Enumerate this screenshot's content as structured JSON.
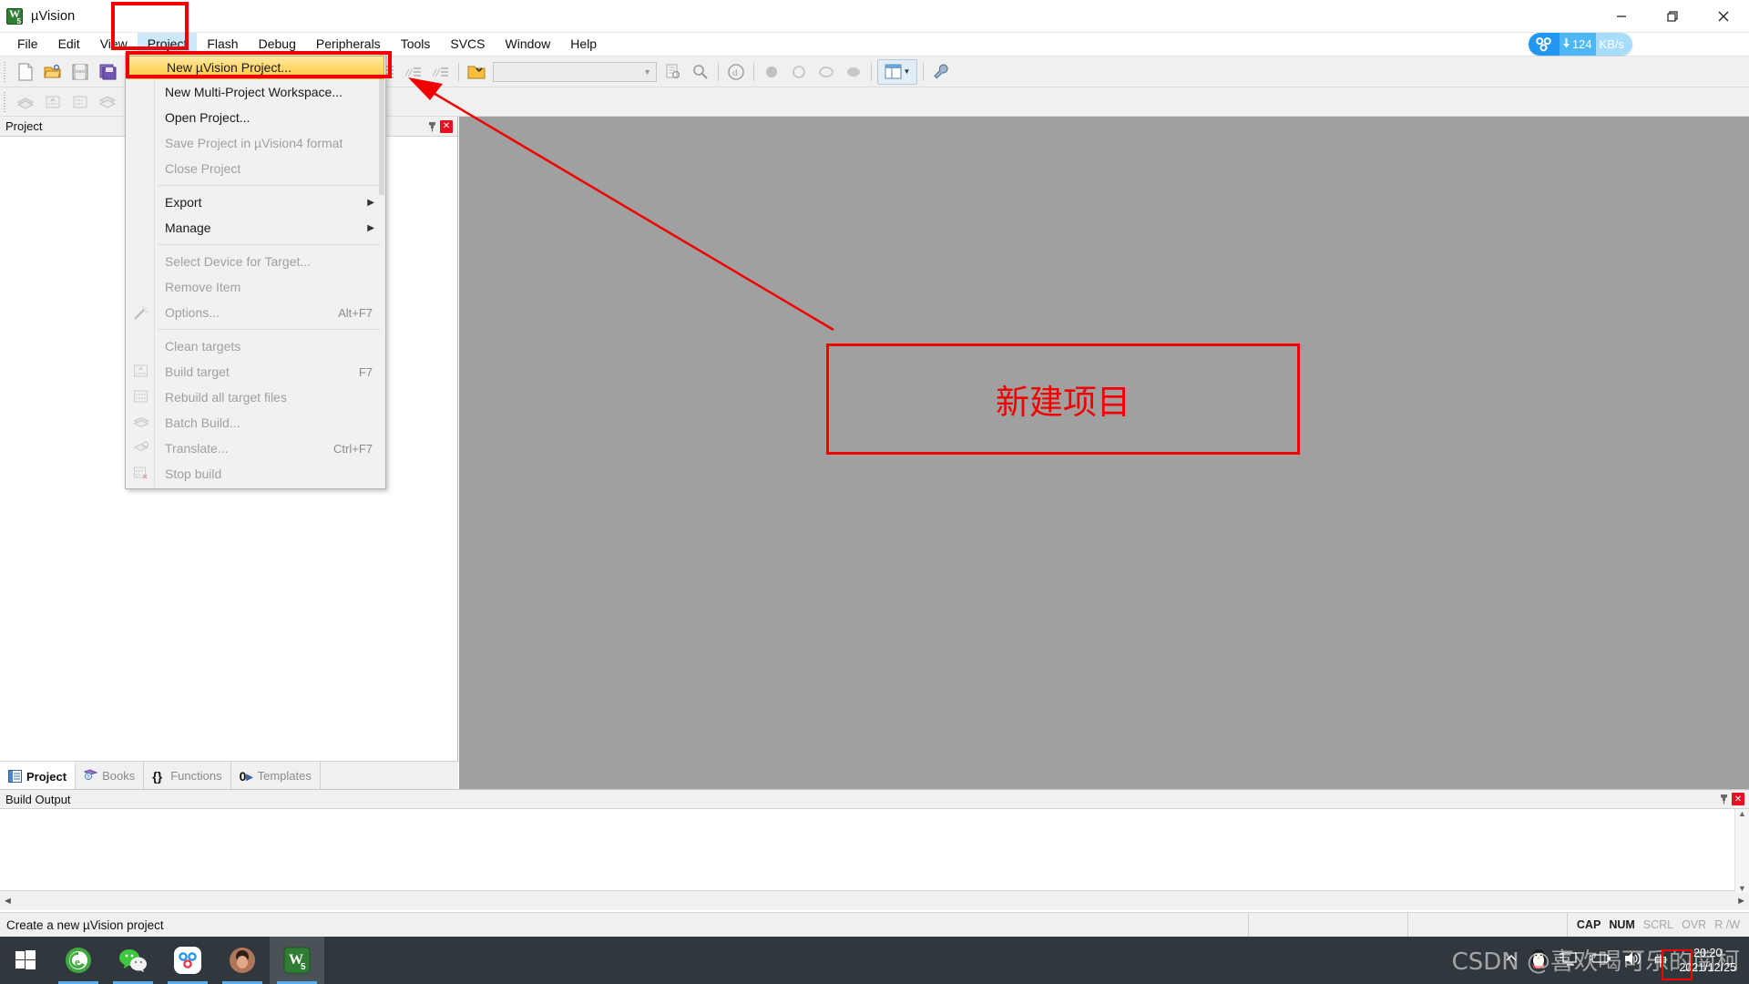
{
  "window": {
    "title": "µVision",
    "app_icon": "uvision-keil-icon",
    "controls": {
      "minimize": "minimize-icon",
      "maximize": "restore-icon",
      "close": "close-icon"
    }
  },
  "menubar": {
    "items": [
      {
        "label": "File",
        "open": false
      },
      {
        "label": "Edit",
        "open": false
      },
      {
        "label": "View",
        "open": false
      },
      {
        "label": "Project",
        "open": true
      },
      {
        "label": "Flash",
        "open": false
      },
      {
        "label": "Debug",
        "open": false
      },
      {
        "label": "Peripherals",
        "open": false
      },
      {
        "label": "Tools",
        "open": false
      },
      {
        "label": "SVCS",
        "open": false
      },
      {
        "label": "Window",
        "open": false
      },
      {
        "label": "Help",
        "open": false
      }
    ]
  },
  "network_badge": {
    "logo": "baidu-netdisk-icon",
    "direction_icon": "download-arrow-icon",
    "speed": "124",
    "unit": "KB/s"
  },
  "project_menu": {
    "items": [
      {
        "label": "New µVision Project...",
        "shortcut": "",
        "disabled": false,
        "highlight": true,
        "icon": "",
        "submenu": false
      },
      {
        "label": "New Multi-Project Workspace...",
        "shortcut": "",
        "disabled": false,
        "highlight": false,
        "icon": "",
        "submenu": false
      },
      {
        "label": "Open Project...",
        "shortcut": "",
        "disabled": false,
        "highlight": false,
        "icon": "",
        "submenu": false
      },
      {
        "label": "Save Project in µVision4 format",
        "shortcut": "",
        "disabled": true,
        "highlight": false,
        "icon": "",
        "submenu": false
      },
      {
        "label": "Close Project",
        "shortcut": "",
        "disabled": true,
        "highlight": false,
        "icon": "",
        "submenu": false
      },
      {
        "separator": true
      },
      {
        "label": "Export",
        "shortcut": "",
        "disabled": false,
        "highlight": false,
        "icon": "",
        "submenu": true
      },
      {
        "label": "Manage",
        "shortcut": "",
        "disabled": false,
        "highlight": false,
        "icon": "",
        "submenu": true
      },
      {
        "separator": true
      },
      {
        "label": "Select Device for Target...",
        "shortcut": "",
        "disabled": true,
        "highlight": false,
        "icon": "",
        "submenu": false
      },
      {
        "label": "Remove Item",
        "shortcut": "",
        "disabled": true,
        "highlight": false,
        "icon": "",
        "submenu": false
      },
      {
        "label": "Options...",
        "shortcut": "Alt+F7",
        "disabled": true,
        "highlight": false,
        "icon": "options-wand-icon",
        "submenu": false
      },
      {
        "separator": true
      },
      {
        "label": "Clean targets",
        "shortcut": "",
        "disabled": true,
        "highlight": false,
        "icon": "",
        "submenu": false
      },
      {
        "label": "Build target",
        "shortcut": "F7",
        "disabled": true,
        "highlight": false,
        "icon": "build-target-icon",
        "submenu": false
      },
      {
        "label": "Rebuild all target files",
        "shortcut": "",
        "disabled": true,
        "highlight": false,
        "icon": "rebuild-icon",
        "submenu": false
      },
      {
        "label": "Batch Build...",
        "shortcut": "",
        "disabled": true,
        "highlight": false,
        "icon": "batch-build-icon",
        "submenu": false
      },
      {
        "label": "Translate...",
        "shortcut": "Ctrl+F7",
        "disabled": true,
        "highlight": false,
        "icon": "translate-icon",
        "submenu": false
      },
      {
        "label": "Stop build",
        "shortcut": "",
        "disabled": true,
        "highlight": false,
        "icon": "stop-build-icon",
        "submenu": false
      }
    ]
  },
  "toolbar_main": {
    "buttons": [
      "new-file-icon",
      "open-file-icon",
      "save-icon",
      "save-all-icon",
      "cut-icon",
      "copy-icon",
      "paste-icon",
      "undo-icon",
      "redo-icon",
      "back-icon",
      "forward-icon",
      "indent-icon",
      "outdent-icon",
      "comment-icon",
      "uncomment-icon",
      "bookmark-folder-icon"
    ],
    "combo_value": "",
    "combo_chevron": "chevron-down-icon",
    "right_buttons": [
      "find-in-files-icon",
      "find-icon",
      "zoom-icon",
      "debug-start-icon",
      "breakpoint-icon",
      "disable-breakpoint-icon",
      "kill-breakpoints-icon"
    ],
    "window_split": "window-split-icon",
    "configure_icon": "wrench-icon"
  },
  "toolbar_build": {
    "buttons": [
      "batch-build-icon",
      "build-icon",
      "rebuild-icon",
      "layers-icon",
      "download-icon",
      "target-options-icon",
      "manage-rte-icon",
      "packs-icon"
    ]
  },
  "project_panel": {
    "title": "Project",
    "pin_icon": "pin-icon",
    "close_icon": "close-icon",
    "tabs": [
      {
        "label": "Project",
        "icon": "project-tree-icon",
        "active": true
      },
      {
        "label": "Books",
        "icon": "books-icon",
        "active": false
      },
      {
        "label": "Functions",
        "icon": "braces-icon",
        "active": false
      },
      {
        "label": "Templates",
        "icon": "templates-icon",
        "active": false
      }
    ]
  },
  "build_output": {
    "title": "Build Output",
    "pin_icon": "pin-icon",
    "close_icon": "close-icon",
    "content": "",
    "scroll_left": "◄",
    "scroll_right": "►",
    "scroll_up": "▲",
    "scroll_down": "▼"
  },
  "statusbar": {
    "message": "Create a new µVision project",
    "flags": [
      {
        "label": "CAP",
        "active": true
      },
      {
        "label": "NUM",
        "active": true
      },
      {
        "label": "SCRL",
        "active": false
      },
      {
        "label": "OVR",
        "active": false
      },
      {
        "label": "R /W",
        "active": false
      }
    ]
  },
  "annotations": {
    "big_box_text": "新建项目",
    "color": "#f20000",
    "arrow": "red-arrow-pointer"
  },
  "taskbar": {
    "start_icon": "windows-start-icon",
    "apps": [
      {
        "name": "360-browser-icon",
        "running": true,
        "active": false
      },
      {
        "name": "wechat-icon",
        "running": true,
        "active": false
      },
      {
        "name": "baidu-netdisk-icon",
        "running": true,
        "active": false
      },
      {
        "name": "user-avatar-icon",
        "running": true,
        "active": false
      },
      {
        "name": "uvision-keil-icon",
        "running": true,
        "active": true
      }
    ],
    "tray": [
      "show-hidden-icons-chevron",
      "qq-penguin-icon",
      "network-monitor-icon",
      "battery-icon",
      "volume-icon",
      "ime-chinese-icon"
    ],
    "clock_time": "20:20",
    "clock_date": "2021/12/25",
    "watermark": "CSDN @喜欢喝可乐的南柯"
  }
}
